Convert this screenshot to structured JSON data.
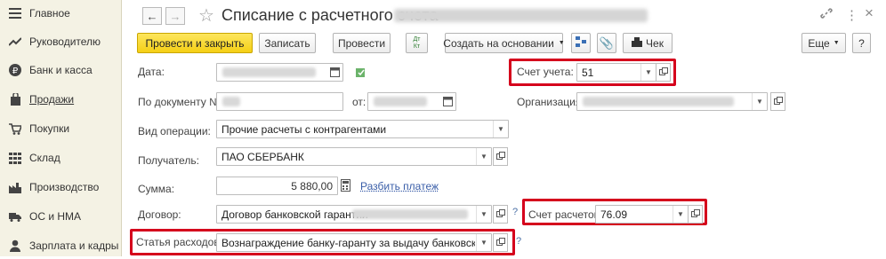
{
  "sidebar": {
    "items": [
      {
        "label": "Главное",
        "icon": "menu-icon"
      },
      {
        "label": "Руководителю",
        "icon": "trend-icon"
      },
      {
        "label": "Банк и касса",
        "icon": "ruble-icon"
      },
      {
        "label": "Продажи",
        "icon": "bag-icon"
      },
      {
        "label": "Покупки",
        "icon": "cart-icon"
      },
      {
        "label": "Склад",
        "icon": "grid-icon"
      },
      {
        "label": "Производство",
        "icon": "factory-icon"
      },
      {
        "label": "ОС и НМА",
        "icon": "truck-icon"
      },
      {
        "label": "Зарплата и кадры",
        "icon": "person-icon"
      }
    ]
  },
  "titlebar": {
    "back": "←",
    "forward": "→",
    "star": "☆",
    "title": "Списание с расчетного счета",
    "link_icon": "🔗",
    "more_icon": "⋮",
    "close_icon": "×"
  },
  "toolbar": {
    "post_close": "Провести и закрыть",
    "save": "Записать",
    "post": "Провести",
    "dtkt": "Дт Кт",
    "create_based": "Создать на основании",
    "check": "Чек",
    "more": "Еще",
    "help": "?"
  },
  "form": {
    "date_label": "Дата:",
    "account_label": "Счет учета:",
    "account_value": "51",
    "doc_number_label": "По документу №:",
    "from_label": "от:",
    "org_label": "Организация:",
    "op_type_label": "Вид операции:",
    "op_type_value": "Прочие расчеты с контрагентами",
    "recipient_label": "Получатель:",
    "recipient_value": "ПАО СБЕРБАНК",
    "amount_label": "Сумма:",
    "amount_value": "5 880,00",
    "split_link": "Разбить платеж",
    "contract_label": "Договор:",
    "contract_value": "Договор банковской гарантии",
    "settle_account_label": "Счет расчетов:",
    "settle_account_value": "76.09",
    "expense_label": "Статья расходов:",
    "expense_value": "Вознаграждение банку-гаранту за выдачу банковской гаран",
    "q_mark": "?"
  },
  "colors": {
    "primary_button": "#f5cf15",
    "highlight": "#d5001c",
    "sidebar_bg": "#f4f2e4",
    "link": "#3a5ea8"
  }
}
